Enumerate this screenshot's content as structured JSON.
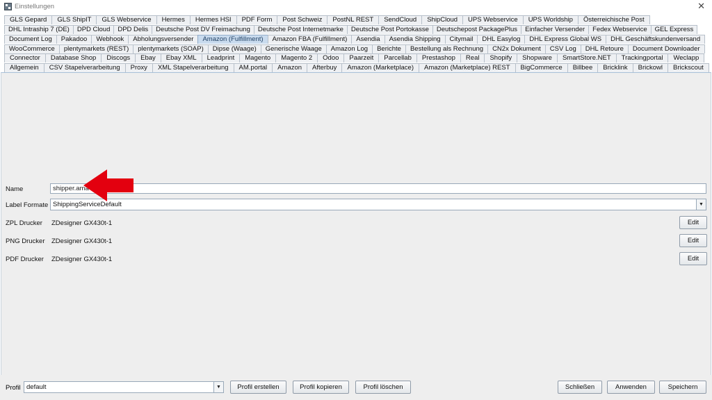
{
  "window": {
    "title": "Einstellungen",
    "close_glyph": "✕"
  },
  "tabs": {
    "row1": [
      "GLS Gepard",
      "GLS ShipIT",
      "GLS Webservice",
      "Hermes",
      "Hermes HSI",
      "PDF Form",
      "Post Schweiz",
      "PostNL REST",
      "SendCloud",
      "ShipCloud",
      "UPS Webservice",
      "UPS Worldship",
      "Österreichische Post"
    ],
    "row2": [
      "DHL Intraship 7 (DE)",
      "DPD Cloud",
      "DPD Delis",
      "Deutsche Post DV Freimachung",
      "Deutsche Post Internetmarke",
      "Deutsche Post Portokasse",
      "Deutschepost PackagePlus",
      "Einfacher Versender",
      "Fedex Webservice",
      "GEL Express"
    ],
    "row3": [
      "Document Log",
      "Pakadoo",
      "Webhook",
      "Abholungsversender",
      "Amazon (Fulfillment)",
      "Amazon FBA (Fulfillment)",
      "Asendia",
      "Asendia Shipping",
      "Citymail",
      "DHL Easylog",
      "DHL Express Global WS",
      "DHL Geschäftskundenversand"
    ],
    "row4": [
      "WooCommerce",
      "plentymarkets (REST)",
      "plentymarkets (SOAP)",
      "Dipse (Waage)",
      "Generische Waage",
      "Amazon Log",
      "Berichte",
      "Bestellung als Rechnung",
      "CN2x Dokument",
      "CSV Log",
      "DHL Retoure",
      "Document Downloader"
    ],
    "row5": [
      "Connector",
      "Database Shop",
      "Discogs",
      "Ebay",
      "Ebay XML",
      "Leadprint",
      "Magento",
      "Magento 2",
      "Odoo",
      "Paarzeit",
      "Parcellab",
      "Prestashop",
      "Real",
      "Shopify",
      "Shopware",
      "SmartStore.NET",
      "Trackingportal",
      "Weclapp"
    ],
    "row6": [
      "Allgemein",
      "CSV Stapelverarbeitung",
      "Proxy",
      "XML Stapelverarbeitung",
      "AM.portal",
      "Amazon",
      "Afterbuy",
      "Amazon (Marketplace)",
      "Amazon (Marketplace) REST",
      "BigCommerce",
      "Billbee",
      "Bricklink",
      "Brickowl",
      "Brickscout"
    ],
    "selected": "Amazon (Fulfillment)"
  },
  "form": {
    "name_label": "Name",
    "name_value": "shipper.ama",
    "label_format_label": "Label Formate",
    "label_format_value": "ShippingServiceDefault",
    "zpl_label": "ZPL Drucker",
    "zpl_value": "ZDesigner GX430t-1",
    "png_label": "PNG Drucker",
    "png_value": "ZDesigner GX430t-1",
    "pdf_label": "PDF Drucker",
    "pdf_value": "ZDesigner GX430t-1",
    "edit_label": "Edit"
  },
  "footer": {
    "profile_label": "Profil",
    "profile_value": "default",
    "create_label": "Profil erstellen",
    "copy_label": "Profil kopieren",
    "delete_label": "Profil löschen",
    "close_label": "Schließen",
    "apply_label": "Anwenden",
    "save_label": "Speichern"
  },
  "colors": {
    "annotation_arrow": "#e3000f",
    "selected_tab": "#c9dbee"
  },
  "icons": {
    "app": "app-logo-icon",
    "dropdown": "chevron-down-icon",
    "close": "close-icon",
    "annotation": "red-arrow-icon"
  }
}
